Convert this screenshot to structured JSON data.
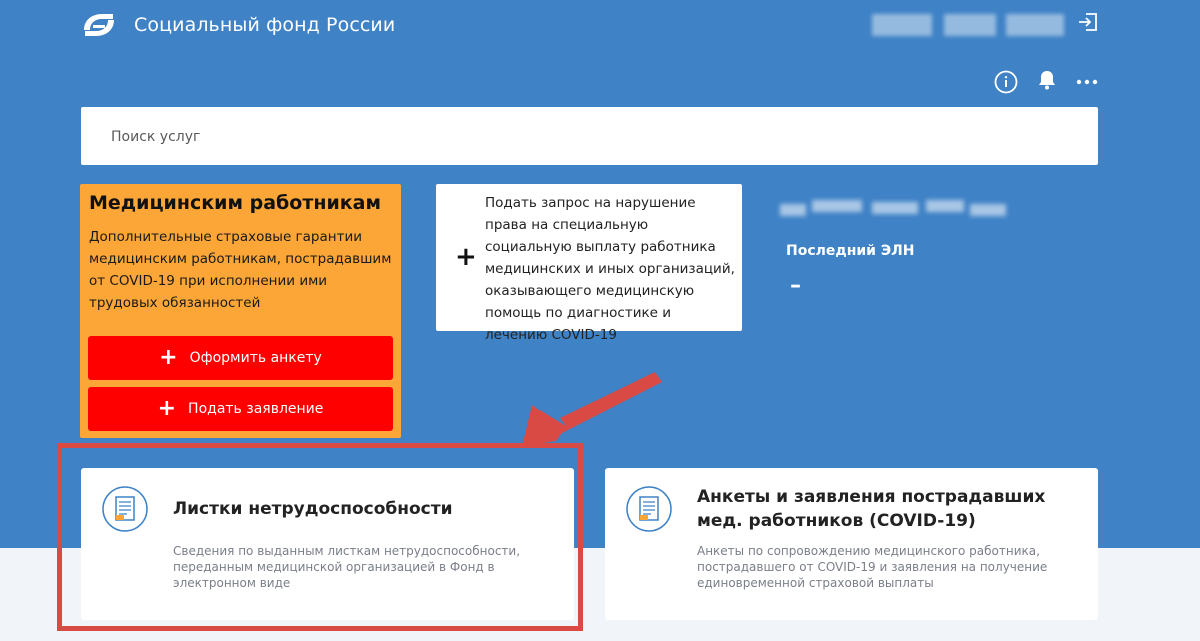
{
  "header": {
    "brand": "Социальный фонд России"
  },
  "search": {
    "placeholder": "Поиск услуг"
  },
  "promo": {
    "title": "Медицинским работникам",
    "text": "Дополнительные страховые гарантии медицинским работникам, пострадавшим от COVID-19 при исполнении ими трудовых обязанностей",
    "buttons": [
      {
        "icon": "plus-icon",
        "label": "Оформить анкету"
      },
      {
        "icon": "plus-icon",
        "label": "Подать заявление"
      }
    ]
  },
  "request_card": {
    "icon": "plus-icon",
    "text": "Подать запрос на нарушение права на специальную социальную выплату работника медицинских и иных организаций, оказывающего медицинскую помощь по диагностике и лечению COVID-19"
  },
  "eln": {
    "label": "Последний ЭЛН",
    "value": "–"
  },
  "cards": [
    {
      "icon": "document-icon",
      "title": "Листки нетрудоспособности",
      "description": "Сведения по выданным листкам нетрудоспособности, переданным медицинской организацией в Фонд в электронном виде"
    },
    {
      "icon": "document-icon",
      "title": "Анкеты и заявления пострадавших мед. работников (COVID-19)",
      "description": "Анкеты по сопровождению медицинского работника, пострадавшего от COVID-19 и заявления на получение единовременной страховой выплаты"
    }
  ],
  "colors": {
    "header_bg": "#3f82c6",
    "promo_bg": "#fba637",
    "action_red": "#ff0000",
    "highlight": "#d84a43"
  }
}
